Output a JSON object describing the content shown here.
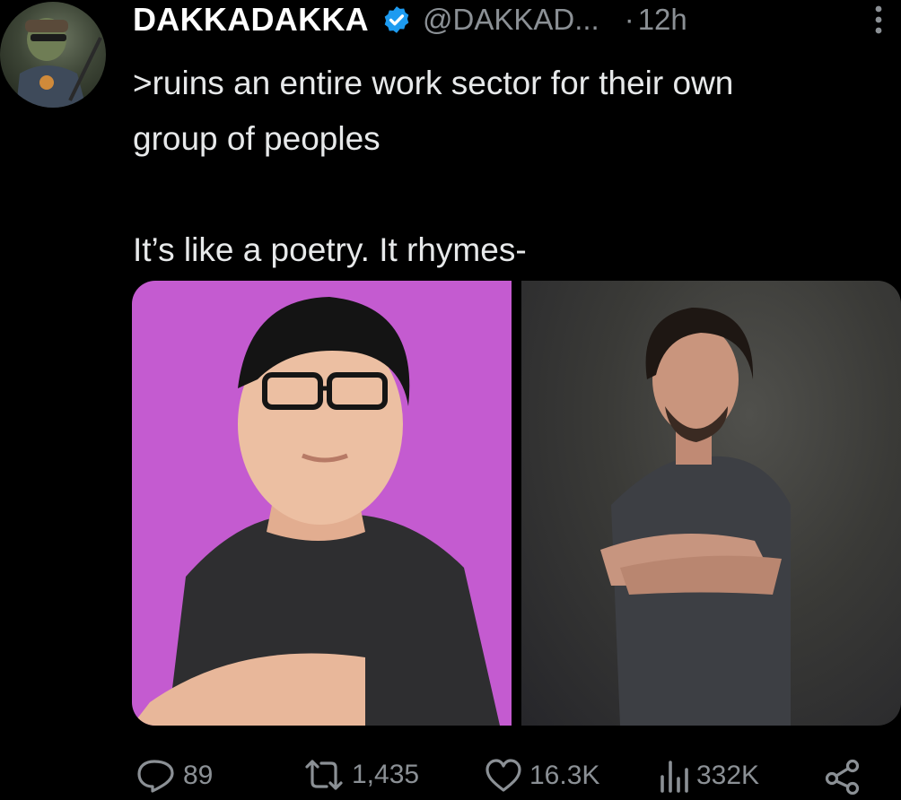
{
  "tweet": {
    "display_name": "DAKKADAKKA",
    "handle": "@DAKKAD...",
    "separator": "·",
    "time": "12h",
    "verified": true,
    "text_lines": [
      ">ruins an entire work sector for their own",
      "group of peoples",
      "It’s like a poetry. It rhymes-"
    ]
  },
  "actions": {
    "replies": "89",
    "retweets": "1,435",
    "likes": "16.3K",
    "views": "332K"
  },
  "icons": {
    "verified": "verified-badge-icon",
    "more": "more-options-icon",
    "reply": "reply-icon",
    "retweet": "retweet-icon",
    "like": "heart-icon",
    "views": "views-icon",
    "share": "share-icon"
  },
  "colors": {
    "background": "#000000",
    "text": "#e7e9ea",
    "muted": "#8b9095",
    "verified": "#1d9bf0",
    "left_photo_bg": "#c45bd0",
    "right_photo_bg": "#3a3a37"
  }
}
